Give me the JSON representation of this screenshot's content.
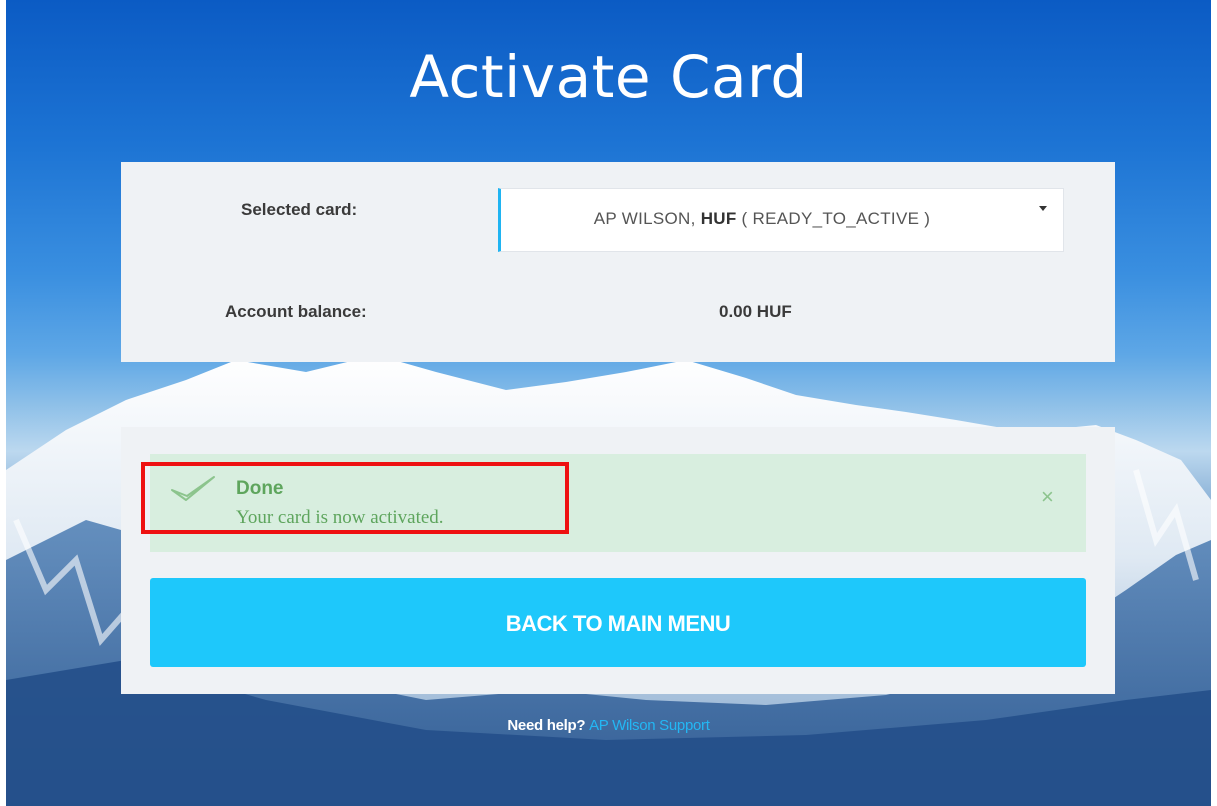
{
  "page": {
    "title": "Activate Card"
  },
  "card_selector": {
    "label": "Selected card:",
    "selected_name": "AP WILSON, ",
    "selected_currency": "HUF",
    "selected_status": " ( READY_TO_ACTIVE )"
  },
  "balance": {
    "label": "Account balance:",
    "value": "0.00 HUF"
  },
  "alert": {
    "title": "Done",
    "message": "Your card is now activated.",
    "close_symbol": "×"
  },
  "actions": {
    "back_label": "BACK TO MAIN MENU"
  },
  "footer": {
    "help_prefix": "Need help? ",
    "help_link": "AP Wilson Support"
  },
  "colors": {
    "accent": "#1ec8fb",
    "success_bg": "#d8eedf",
    "success_text": "#5ea55d",
    "highlight": "#ee1111"
  }
}
